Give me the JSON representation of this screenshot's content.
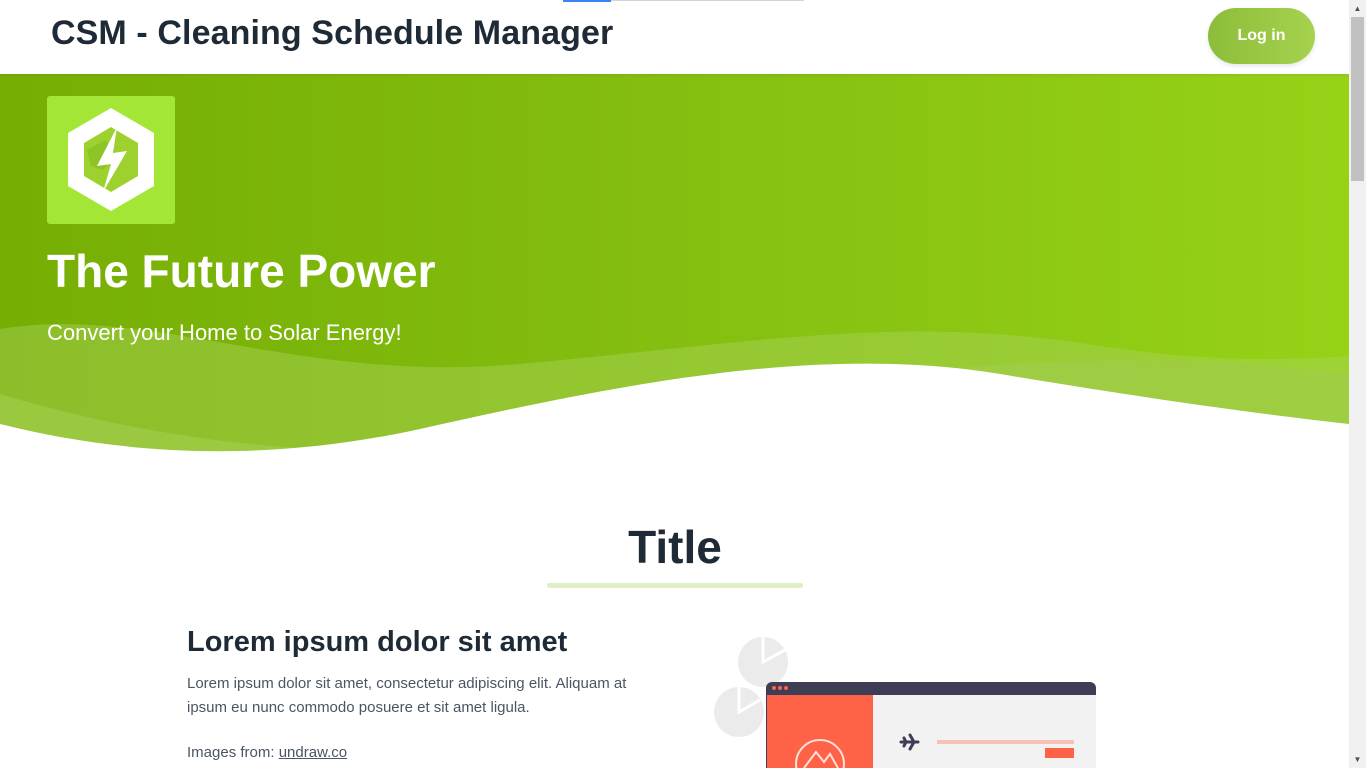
{
  "navbar": {
    "brand": "CSM - Cleaning Schedule Manager",
    "login_label": "Log in"
  },
  "hero": {
    "logo_icon": "lightning-hexagon-icon",
    "title": "The Future Power",
    "subtitle": "Convert your Home to Solar Energy!"
  },
  "section": {
    "title": "Title",
    "heading": "Lorem ipsum dolor sit amet",
    "text": "Lorem ipsum dolor sit amet, consectetur adipiscing elit. Aliquam at ipsum eu nunc commodo posuere et sit amet ligula.",
    "credit_prefix": "Images from: ",
    "credit_link": "undraw.co"
  },
  "colors": {
    "accent": "#8cbd3a",
    "hero_start": "#76ae04",
    "hero_end": "#97d217",
    "text_dark": "#1f2a37",
    "illustration_red": "#ff6347"
  }
}
